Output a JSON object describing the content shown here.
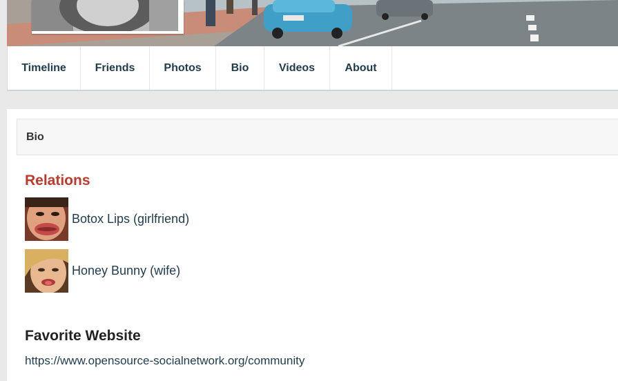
{
  "nav": {
    "tabs": [
      {
        "label": "Timeline"
      },
      {
        "label": "Friends"
      },
      {
        "label": "Photos"
      },
      {
        "label": "Bio"
      },
      {
        "label": "Videos"
      },
      {
        "label": "About"
      }
    ]
  },
  "panel": {
    "header": "Bio"
  },
  "relations": {
    "title": "Relations",
    "items": [
      {
        "name": "Botox Lips (girlfriend)"
      },
      {
        "name": "Honey Bunny (wife)"
      }
    ]
  },
  "favorite_website": {
    "title": "Favorite Website",
    "url": "https://www.opensource-socialnetwork.org/community"
  },
  "colors": {
    "accent_red": "#c0392b",
    "link": "#1f3b4d",
    "tab_text": "#1f3b4d"
  }
}
